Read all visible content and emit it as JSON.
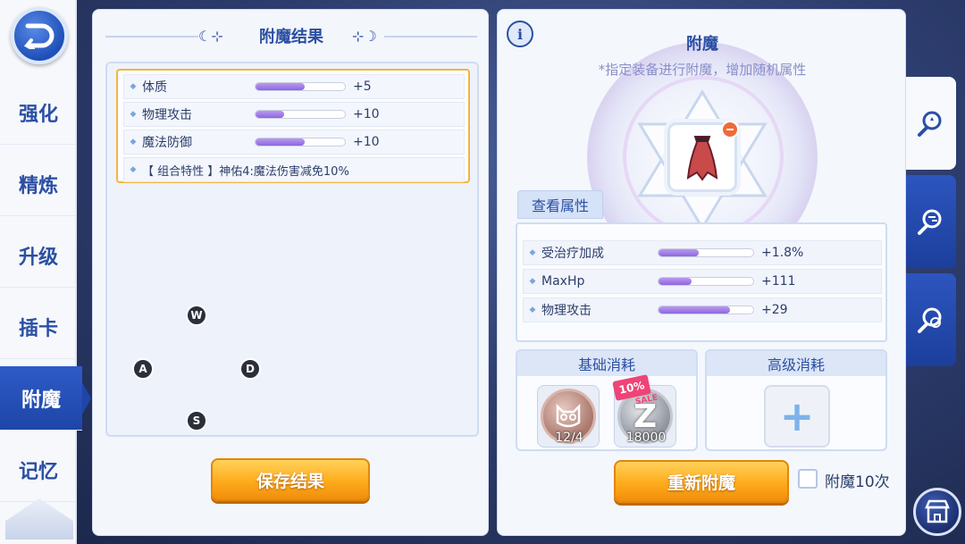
{
  "nav": {
    "items": [
      "强化",
      "精炼",
      "升级",
      "插卡",
      "附魔",
      "记忆"
    ],
    "active": "附魔"
  },
  "result_panel": {
    "title": "附魔结果",
    "attributes": [
      {
        "name": "体质",
        "value": "+5",
        "fill": 0.55
      },
      {
        "name": "物理攻击",
        "value": "+10",
        "fill": 0.32
      },
      {
        "name": "魔法防御",
        "value": "+10",
        "fill": 0.55
      }
    ],
    "combo": "【 组合特性 】神佑4:魔法伤害减免10%",
    "wasd": [
      "W",
      "A",
      "D",
      "S"
    ],
    "save_button": "保存结果"
  },
  "enchant_panel": {
    "info_icon": "i",
    "title": "附魔",
    "subtitle": "*指定装备进行附魔，增加随机属性",
    "equipment_icon": "cape-icon",
    "view_attributes": "查看属性",
    "stats": [
      {
        "name": "受治疗加成",
        "value": "+1.8%",
        "fill": 0.42
      },
      {
        "name": "MaxHp",
        "value": "+111",
        "fill": 0.35
      },
      {
        "name": "物理攻击",
        "value": "+29",
        "fill": 0.75
      }
    ],
    "basic_cost": {
      "label": "基础消耗",
      "items": [
        {
          "icon": "cat-coin-icon",
          "count": "12/4"
        },
        {
          "icon": "zeny-coin-icon",
          "count": "18000"
        }
      ],
      "discount": "10%",
      "sale": "SALE"
    },
    "advanced_cost": {
      "label": "高级消耗",
      "slot": "+"
    },
    "reenchant_button": "重新附魔",
    "ten_times": {
      "label": "附魔10次",
      "checked": false
    }
  },
  "right_tabs": [
    "enchant-wand-icon",
    "enchant-swap-icon",
    "enchant-cycle-icon"
  ],
  "shop_icon": "shop-icon",
  "colors": {
    "accent": "#2b4fa2",
    "orange": "#ffab1c",
    "bar": "#8e66de",
    "highlight": "#f2b53b"
  }
}
